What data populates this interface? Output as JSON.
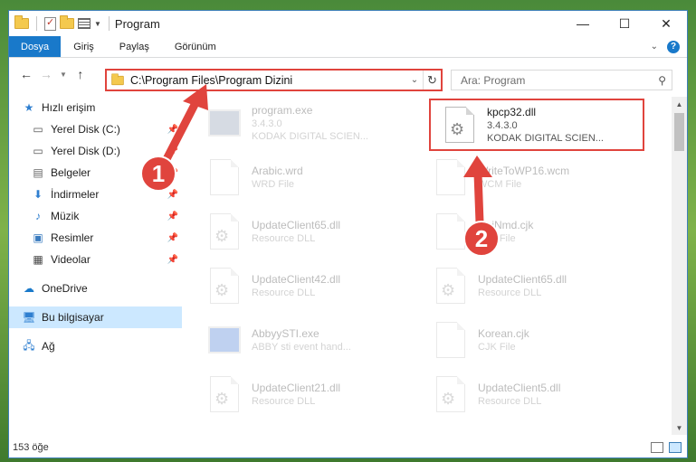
{
  "window": {
    "title": "Program",
    "controls": {
      "minimize": "—",
      "maximize": "☐",
      "close": "✕"
    }
  },
  "ribbon": {
    "tabs": [
      "Dosya",
      "Giriş",
      "Paylaş",
      "Görünüm"
    ],
    "help": "?"
  },
  "address": {
    "path": "C:\\Program Files\\Program Dizini",
    "search_placeholder": "Ara: Program"
  },
  "nav": {
    "quick_access": "Hızlı erişim",
    "items": [
      {
        "label": "Yerel Disk (C:)",
        "icon": "drive-icon",
        "pinned": true
      },
      {
        "label": "Yerel Disk (D:)",
        "icon": "drive-icon",
        "pinned": true
      },
      {
        "label": "Belgeler",
        "icon": "documents-icon",
        "pinned": true
      },
      {
        "label": "İndirmeler",
        "icon": "download-icon",
        "pinned": true
      },
      {
        "label": "Müzik",
        "icon": "music-icon",
        "pinned": true
      },
      {
        "label": "Resimler",
        "icon": "pictures-icon",
        "pinned": true
      },
      {
        "label": "Videolar",
        "icon": "videos-icon",
        "pinned": true
      }
    ],
    "onedrive": "OneDrive",
    "this_pc": "Bu bilgisayar",
    "network": "Ağ"
  },
  "files": [
    {
      "name": "program.exe",
      "line2": "3.4.3.0",
      "line3": "KODAK DIGITAL SCIEN...",
      "kind": "exe",
      "faded": true
    },
    {
      "name": "kpcp32.dll",
      "line2": "3.4.3.0",
      "line3": "KODAK DIGITAL SCIEN...",
      "kind": "dll",
      "faded": false,
      "highlighted": true
    },
    {
      "name": "Arabic.wrd",
      "line2": "WRD File",
      "line3": "",
      "kind": "doc",
      "faded": true
    },
    {
      "name": "WriteToWP16.wcm",
      "line2": "WCM File",
      "line3": "",
      "kind": "doc",
      "faded": true
    },
    {
      "name": "UpdateClient65.dll",
      "line2": "Resource DLL",
      "line3": "",
      "kind": "dll",
      "faded": true
    },
    {
      "name": "UniNmd.cjk",
      "line2": "CJK File",
      "line3": "",
      "kind": "doc",
      "faded": true
    },
    {
      "name": "UpdateClient42.dll",
      "line2": "Resource DLL",
      "line3": "",
      "kind": "dll",
      "faded": true
    },
    {
      "name": "UpdateClient65.dll",
      "line2": "Resource DLL",
      "line3": "",
      "kind": "dll",
      "faded": true
    },
    {
      "name": "AbbyySTI.exe",
      "line2": "ABBY sti event hand...",
      "line3": "",
      "kind": "exe2",
      "faded": true
    },
    {
      "name": "Korean.cjk",
      "line2": "CJK File",
      "line3": "",
      "kind": "doc",
      "faded": true
    },
    {
      "name": "UpdateClient21.dll",
      "line2": "Resource DLL",
      "line3": "",
      "kind": "dll",
      "faded": true
    },
    {
      "name": "UpdateClient5.dll",
      "line2": "Resource DLL",
      "line3": "",
      "kind": "dll",
      "faded": true
    }
  ],
  "status": {
    "count": "153 öğe"
  },
  "annotations": {
    "marker1": "1",
    "marker2": "2",
    "color": "#e0443d"
  }
}
